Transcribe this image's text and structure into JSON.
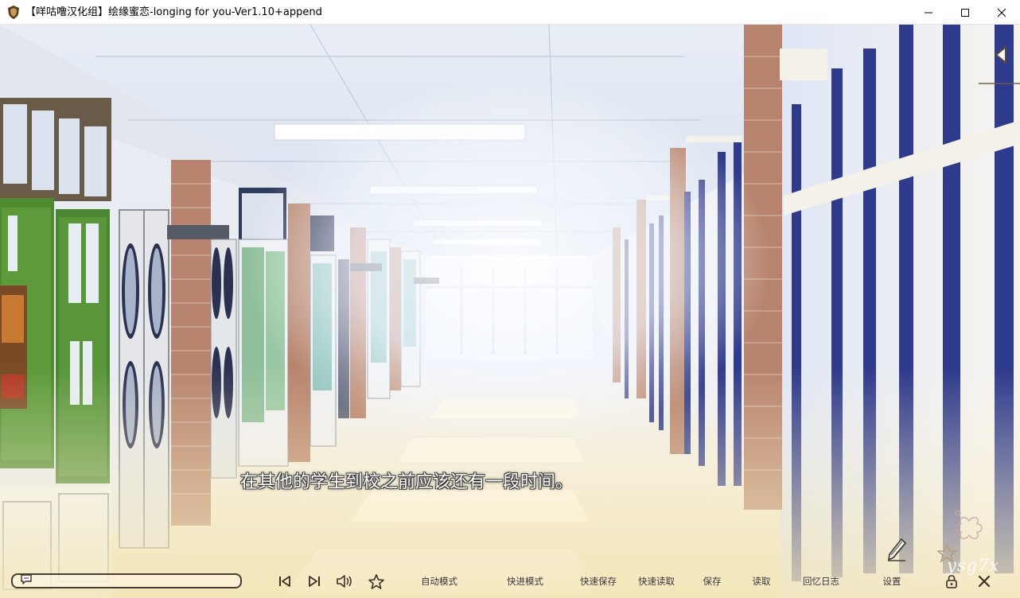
{
  "window": {
    "title": "【咩咕噜汉化组】绘缘蜜恋-longing for you-Ver1.10+append"
  },
  "dialogue": {
    "text": "在其他的学生到校之前应该还有一段时间。"
  },
  "menu": {
    "auto": "自动模式",
    "skip": "快进模式",
    "quick_save": "快速保存",
    "quick_load": "快速读取",
    "save": "保存",
    "load": "读取",
    "backlog": "回忆日志",
    "settings": "设置"
  },
  "watermark": "ysg7x",
  "colors": {
    "ui_dark": "#3a3027",
    "board_green": "#4f8a32",
    "window_blue": "#2e3a8c"
  }
}
